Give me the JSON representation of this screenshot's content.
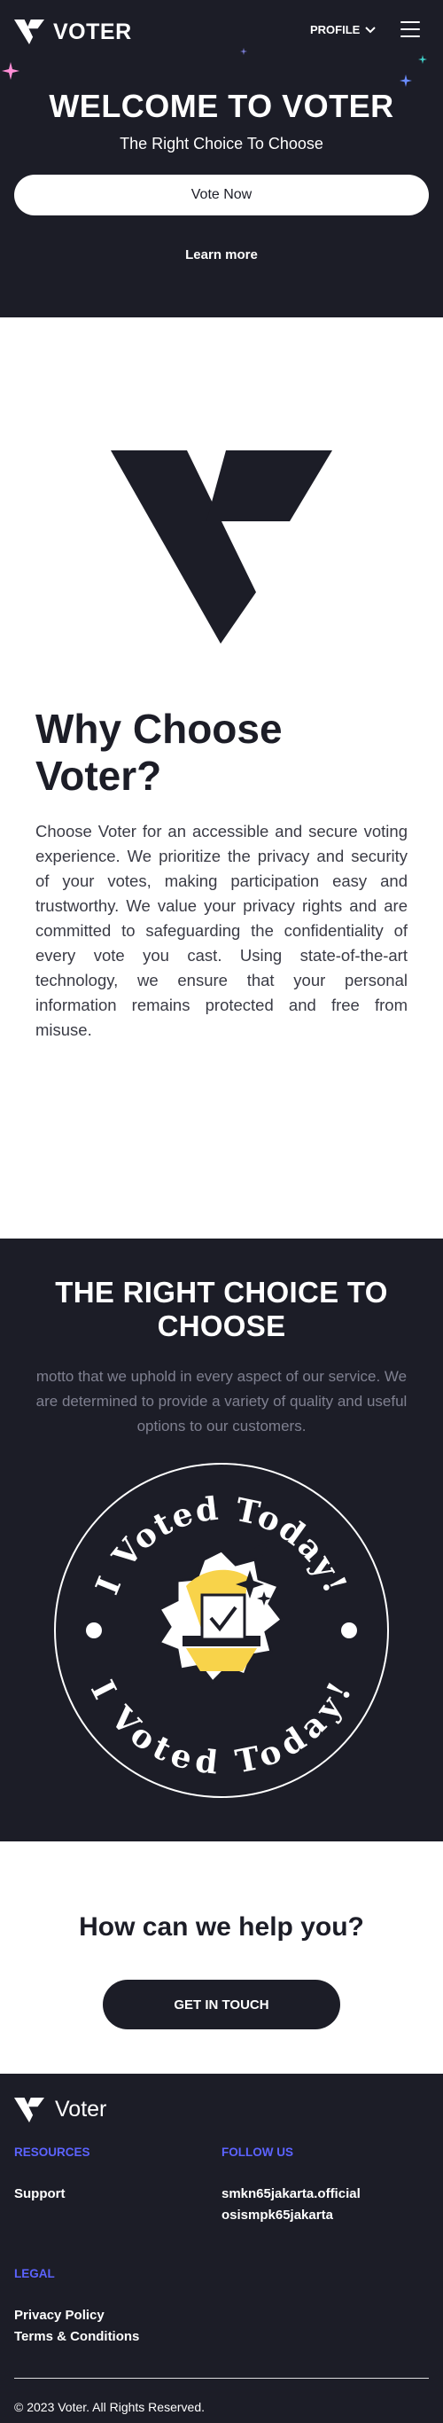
{
  "header": {
    "brand": "VOTER",
    "profile_label": "PROFILE",
    "icons": [
      "voter-logo-icon",
      "chevron-down-icon",
      "menu-icon",
      "sparkle-icon"
    ]
  },
  "hero": {
    "title": "WELCOME TO VOTER",
    "subtitle": "The Right Choice To Choose",
    "vote_button": "Vote Now",
    "learn_more": "Learn more"
  },
  "why": {
    "title": "Why Choose Voter?",
    "text": "Choose Voter for an accessible and secure voting experience. We prioritize the privacy and security of your votes, making participation easy and trustworthy. We value your privacy rights and are committed to safeguarding the confidentiality of every vote you cast. Using state-of-the-art technology, we ensure that your personal information remains protected and free from misuse."
  },
  "choice": {
    "title": "THE RIGHT CHOICE TO CHOOSE",
    "text": "motto that we uphold in every aspect of our service. We are determined to provide a variety of quality and useful options to our customers.",
    "badge_text": "I Voted Today!"
  },
  "help": {
    "title": "How can we help you?",
    "button": "GET IN TOUCH"
  },
  "footer": {
    "brand": "Voter",
    "resources_heading": "RESOURCES",
    "resources_links": [
      "Support"
    ],
    "follow_heading": "FOLLOW US",
    "follow_links": [
      "smkn65jakarta.official",
      "osismpk65jakarta"
    ],
    "legal_heading": "LEGAL",
    "legal_links": [
      "Privacy Policy",
      "Terms & Conditions"
    ],
    "copyright": "© 2023 Voter. All Rights Reserved."
  },
  "colors": {
    "dark": "#1c1d27",
    "accent_blue": "#5c63ff",
    "badge_yellow": "#f8d34a",
    "sparkle_pink": "#ff8ed6",
    "sparkle_teal": "#3fd0c9"
  }
}
